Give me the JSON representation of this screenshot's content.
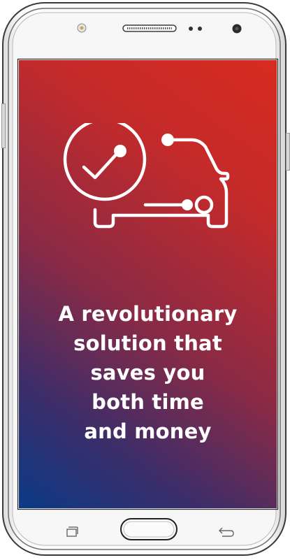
{
  "headline": {
    "lines": [
      "A revolutionary",
      "solution that",
      "saves you",
      "both time",
      "and money"
    ]
  },
  "icons": {
    "hero": "car-check-icon",
    "recent_apps": "recent-apps-icon",
    "home": "home-button",
    "back": "back-icon",
    "camera": "camera-icon",
    "speaker": "speaker-grille",
    "sensors": "sensor-dots"
  },
  "colors": {
    "gradient_top_right": "#d72b1f",
    "gradient_bottom_left": "#0a3a86",
    "text": "#ffffff",
    "frame": "#f4f4f4"
  }
}
